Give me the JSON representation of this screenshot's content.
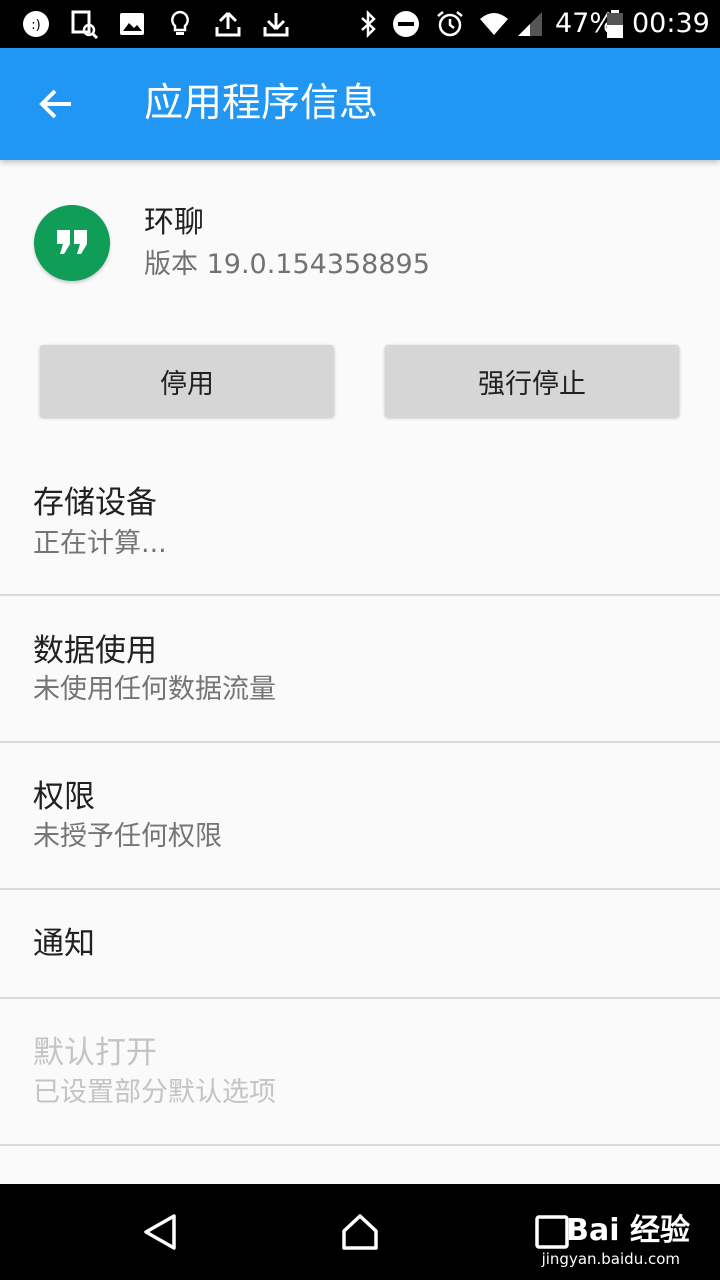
{
  "status_bar": {
    "icons_left": [
      "messenger-icon",
      "screenshot-search-icon",
      "image-icon",
      "lightbulb-icon",
      "upload-icon",
      "download-icon"
    ],
    "icons_right": [
      "bluetooth-icon",
      "do-not-disturb-icon",
      "alarm-icon",
      "wifi-icon",
      "signal-icon",
      "battery-icon"
    ],
    "battery": "47%",
    "time": "00:39"
  },
  "app_bar": {
    "title": "应用程序信息"
  },
  "app": {
    "name": "环聊",
    "version": "版本 19.0.154358895",
    "accent": "#0f9d58"
  },
  "buttons": {
    "disable": "停用",
    "force_stop": "强行停止"
  },
  "items": [
    {
      "title": "存储设备",
      "summary": "正在计算..."
    },
    {
      "title": "数据使用",
      "summary": "未使用任何数据流量"
    },
    {
      "title": "权限",
      "summary": "未授予任何权限"
    },
    {
      "title": "通知",
      "summary": ""
    },
    {
      "title": "默认打开",
      "summary": "已设置部分默认选项"
    }
  ],
  "watermark": {
    "brand": "Bai 经验",
    "url": "jingyan.baidu.com"
  },
  "colors": {
    "app_bar": "#2196f3",
    "status_bar": "#000000",
    "background": "#fafafa"
  }
}
